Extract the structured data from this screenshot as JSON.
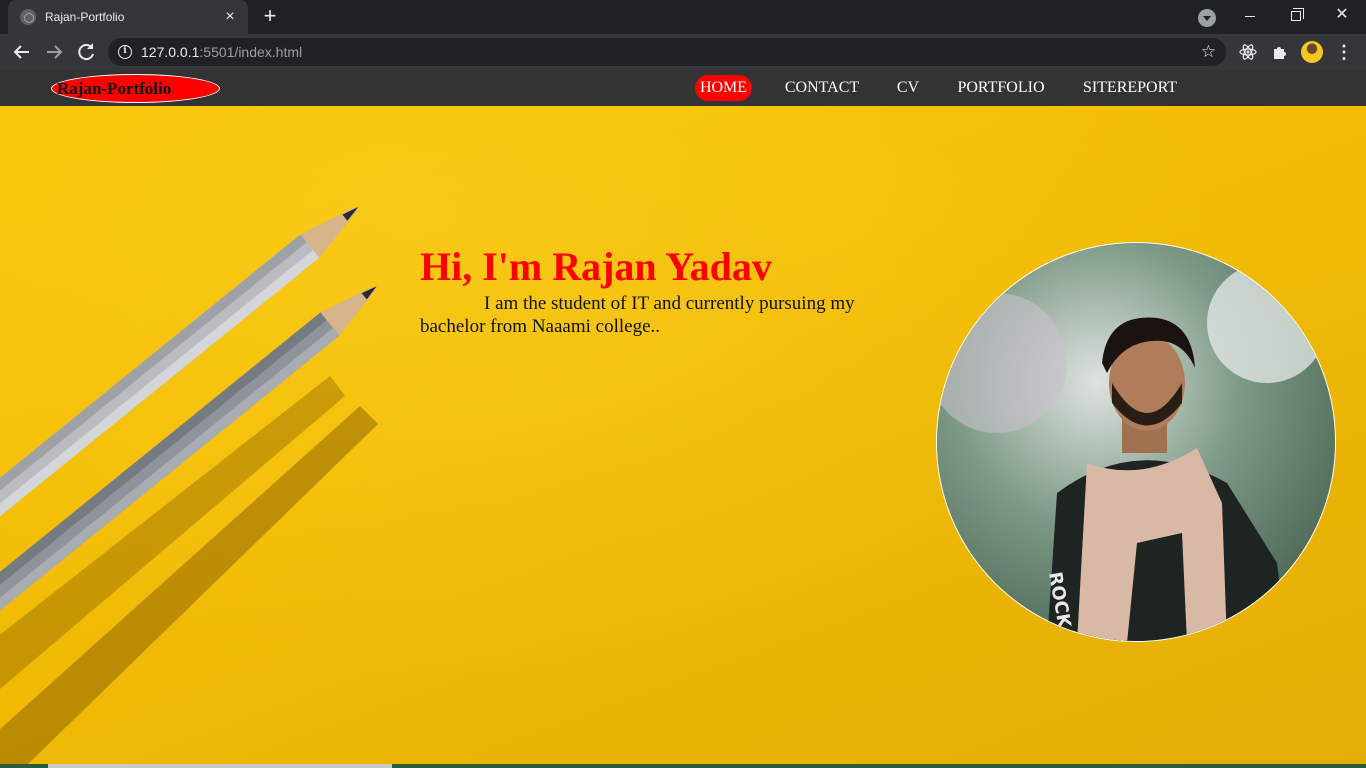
{
  "browser": {
    "tab_title": "Rajan-Portfolio",
    "new_tab_label": "+",
    "tab_close_label": "×",
    "url_host": "127.0.0.1",
    "url_rest": ":5501/index.html",
    "info_icon_label": "i",
    "icons": [
      "globe-icon",
      "close-icon",
      "plus-icon",
      "tab-search-icon",
      "minimize-icon",
      "maximize-icon",
      "window-close-icon",
      "back-arrow-icon",
      "forward-arrow-icon",
      "reload-icon",
      "info-icon",
      "star-icon",
      "react-devtools-icon",
      "puzzle-icon",
      "avatar",
      "more-vert-icon"
    ]
  },
  "site": {
    "brand": "Rajan-Portfolio",
    "nav": [
      {
        "label": "HOME",
        "active": true
      },
      {
        "label": "CONTACT",
        "active": false
      },
      {
        "label": "CV",
        "active": false
      },
      {
        "label": "PORTFOLIO",
        "active": false
      },
      {
        "label": "SITEREPORT",
        "active": false
      }
    ]
  },
  "hero": {
    "headline": "Hi, I'm Rajan Yadav",
    "bio": "I am the student of IT and currently pursuing my bachelor from Naaami college.."
  },
  "colors": {
    "accent": "#ff0000",
    "background": "#f5c000",
    "nav_bg": "#333333"
  }
}
